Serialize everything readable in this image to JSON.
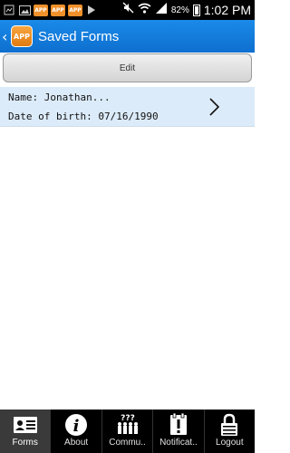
{
  "status_bar": {
    "battery": "82%",
    "time": "1:02 PM",
    "app_badges": [
      "APP",
      "APP",
      "APP"
    ]
  },
  "header": {
    "back": "‹",
    "logo_text": "APP",
    "title": "Saved Forms"
  },
  "toolbar": {
    "edit_label": "Edit"
  },
  "forms": [
    {
      "name_line": "Name: Jonathan...",
      "dob_line": "Date of birth: 07/16/1990"
    }
  ],
  "tabs": [
    {
      "label": "Forms",
      "icon": "id-card-icon",
      "active": true
    },
    {
      "label": "About",
      "icon": "info-icon",
      "active": false
    },
    {
      "label": "Commu..",
      "icon": "community-icon",
      "active": false
    },
    {
      "label": "Notificat..",
      "icon": "notification-icon",
      "active": false
    },
    {
      "label": "Logout",
      "icon": "lock-icon",
      "active": false
    }
  ],
  "colors": {
    "action_bar": "#0e6fcf",
    "selected_row": "#dcebf9",
    "app_logo": "#f0902a"
  }
}
